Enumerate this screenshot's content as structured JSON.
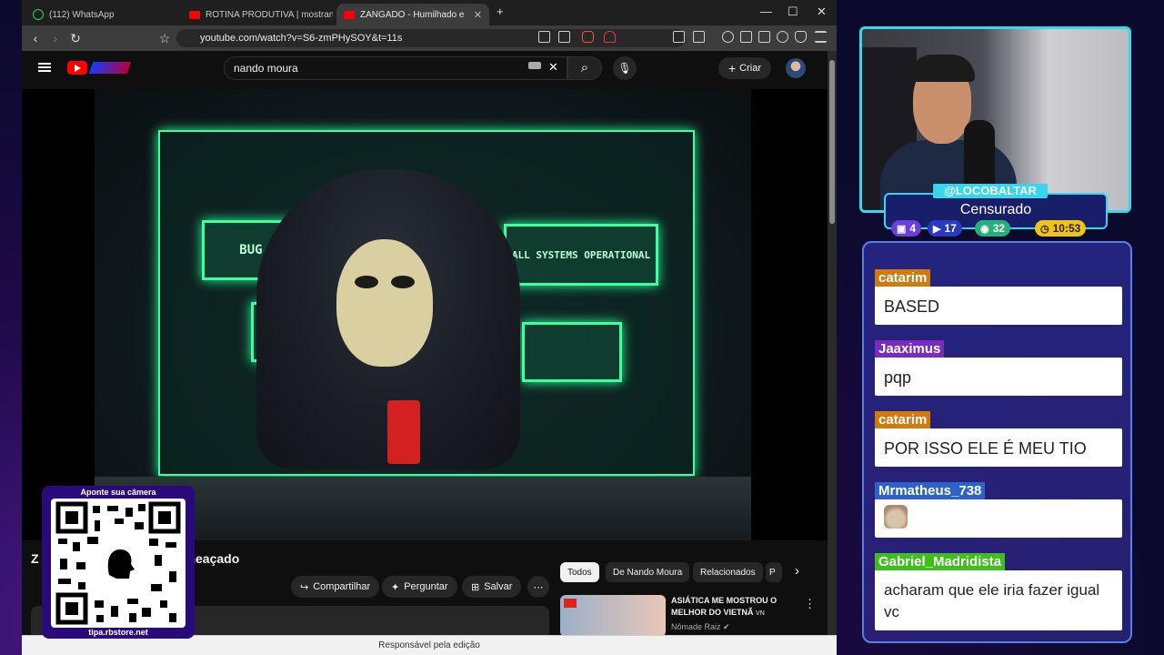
{
  "browser": {
    "tabs": [
      {
        "label": "(112) WhatsApp",
        "icon": "whatsapp-icon"
      },
      {
        "label": "ROTINA PRODUTIVA | mostrando meus hábi",
        "icon": "youtube-icon"
      },
      {
        "label": "ZANGADO - Humilhado e Ameaçado",
        "icon": "youtube-icon"
      }
    ],
    "url": "youtube.com/watch?v=S6-zmPHySOY&t=11s",
    "status_bar": "Responsável pela edição"
  },
  "youtube": {
    "search_value": "nando moura",
    "create_label": "Criar",
    "video_title_start": "Z",
    "video_title_end": "meaçado",
    "actions": {
      "share": "Compartilhar",
      "ask": "Perguntar",
      "save": "Salvar"
    },
    "chips": [
      "Todos",
      "De Nando Moura",
      "Relacionados",
      "P"
    ],
    "recommended": {
      "title": "ASIÁTICA ME MOSTROU O MELHOR DO VIETNÃ",
      "badge": "VN",
      "channel": "Nômade Raiz"
    },
    "screens": {
      "left": "BUG HUNT",
      "right": "ALL SYSTEMS OPERATIONAL"
    }
  },
  "qr": {
    "caption": "Aponte sua câmera",
    "url": "tipa.rbstore.net"
  },
  "stream": {
    "handle": "@LOCOBALTAR",
    "title": "Censurado",
    "stats": {
      "twitch": "4",
      "youtube": "17",
      "kick": "32",
      "timer": "10:53"
    }
  },
  "chat": {
    "messages": [
      {
        "user": "catarim",
        "text": "BASED",
        "color": "#d07a10"
      },
      {
        "user": "Jaaximus",
        "text": "pqp",
        "color": "#7a2cc0"
      },
      {
        "user": "catarim",
        "text": "POR ISSO ELE É MEU TIO",
        "color": "#d07a10"
      },
      {
        "user": "Mrmatheus_738",
        "text": "",
        "color": "#2d62c9"
      },
      {
        "user": "Gabriel_Madridista",
        "text": "acharam que ele iria fazer igual vc",
        "color": "#3fbe1e"
      }
    ]
  },
  "colors": {
    "accent": "#37d6ea",
    "youtube_red": "#ff0000"
  }
}
